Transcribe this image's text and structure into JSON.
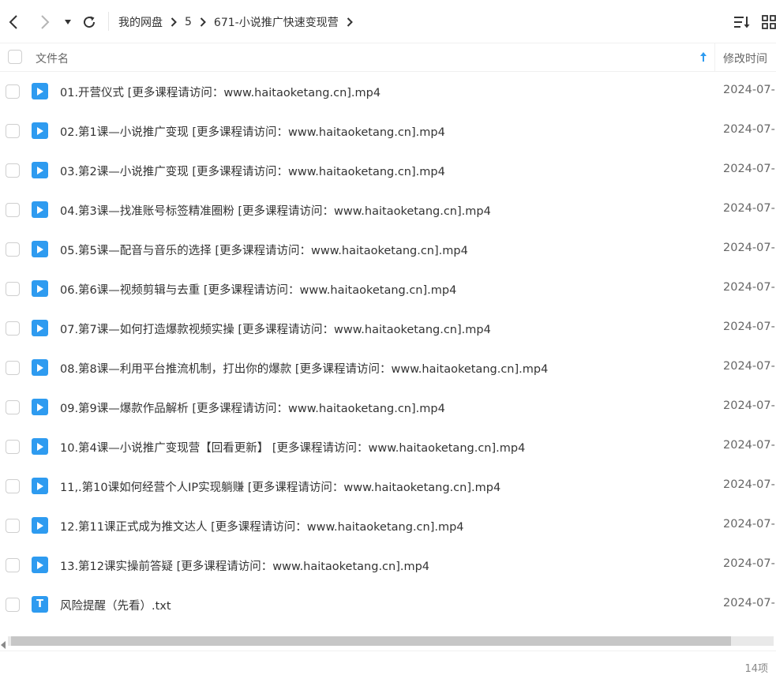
{
  "toolbar": {
    "back_icon": "chevron-left-icon",
    "forward_icon": "chevron-right-icon",
    "history_dropdown_icon": "caret-down-icon",
    "refresh_icon": "refresh-icon",
    "sort_icon": "sort-list-icon",
    "grid_view_icon": "grid-icon"
  },
  "breadcrumb": [
    "我的网盘",
    "5",
    "671-小说推广快速变现营"
  ],
  "header": {
    "name_label": "文件名",
    "time_label": "修改时间",
    "sort_direction": "ascending"
  },
  "files": [
    {
      "name": "01.开营仪式 [更多课程请访问：www.haitaoketang.cn].mp4",
      "date": "2024-07-",
      "type": "video"
    },
    {
      "name": "02.第1课—小说推广变现 [更多课程请访问：www.haitaoketang.cn].mp4",
      "date": "2024-07-",
      "type": "video"
    },
    {
      "name": "03.第2课—小说推广变现 [更多课程请访问：www.haitaoketang.cn].mp4",
      "date": "2024-07-",
      "type": "video"
    },
    {
      "name": "04.第3课—找准账号标签精准圈粉 [更多课程请访问：www.haitaoketang.cn].mp4",
      "date": "2024-07-",
      "type": "video"
    },
    {
      "name": "05.第5课—配音与音乐的选择 [更多课程请访问：www.haitaoketang.cn].mp4",
      "date": "2024-07-",
      "type": "video"
    },
    {
      "name": "06.第6课—视频剪辑与去重 [更多课程请访问：www.haitaoketang.cn].mp4",
      "date": "2024-07-",
      "type": "video"
    },
    {
      "name": "07.第7课—如何打造爆款视频实操 [更多课程请访问：www.haitaoketang.cn].mp4",
      "date": "2024-07-",
      "type": "video"
    },
    {
      "name": "08.第8课—利用平台推流机制，打出你的爆款 [更多课程请访问：www.haitaoketang.cn].mp4",
      "date": "2024-07-",
      "type": "video"
    },
    {
      "name": "09.第9课—爆款作品解析 [更多课程请访问：www.haitaoketang.cn].mp4",
      "date": "2024-07-",
      "type": "video"
    },
    {
      "name": "10.第4课—小说推广变现营【回看更新】 [更多课程请访问：www.haitaoketang.cn].mp4",
      "date": "2024-07-",
      "type": "video"
    },
    {
      "name": "11,.第10课如何经营个人IP实现躺赚 [更多课程请访问：www.haitaoketang.cn].mp4",
      "date": "2024-07-",
      "type": "video"
    },
    {
      "name": "12.第11课正式成为推文达人 [更多课程请访问：www.haitaoketang.cn].mp4",
      "date": "2024-07-",
      "type": "video"
    },
    {
      "name": "13.第12课实操前答疑 [更多课程请访问：www.haitaoketang.cn].mp4",
      "date": "2024-07-",
      "type": "video"
    },
    {
      "name": "风险提醒（先看）.txt",
      "date": "2024-07-",
      "type": "text",
      "icon_letter": "T"
    }
  ],
  "footer": {
    "item_count": "14项"
  },
  "colors": {
    "accent": "#2e9bf0",
    "text": "#333333",
    "muted": "#666666"
  }
}
